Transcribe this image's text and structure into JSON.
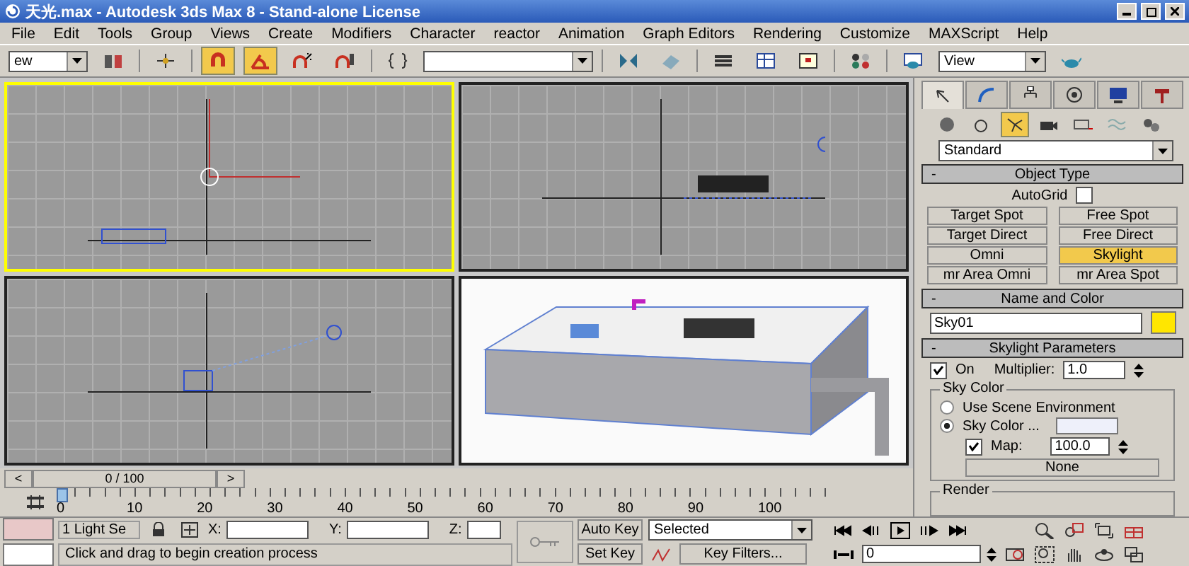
{
  "window": {
    "title": "天光.max - Autodesk 3ds Max 8  - Stand-alone License"
  },
  "menu": [
    "File",
    "Edit",
    "Tools",
    "Group",
    "Views",
    "Create",
    "Modifiers",
    "Character",
    "reactor",
    "Animation",
    "Graph Editors",
    "Rendering",
    "Customize",
    "MAXScript",
    "Help"
  ],
  "toolbar": {
    "selection_filter": "ew",
    "reference_coord": "View",
    "snaps": [
      {
        "kind": "snap",
        "selected": true
      },
      {
        "kind": "angle",
        "selected": true
      },
      {
        "kind": "percent",
        "selected": false
      },
      {
        "kind": "spinner",
        "selected": false
      }
    ]
  },
  "viewports": [
    {
      "kind": "top",
      "selected": true
    },
    {
      "kind": "front",
      "selected": false
    },
    {
      "kind": "left",
      "selected": false
    },
    {
      "kind": "perspective",
      "selected": false
    }
  ],
  "command_panel": {
    "tabs": [
      {
        "kind": "create",
        "selected": true
      },
      {
        "kind": "modify",
        "selected": false
      },
      {
        "kind": "hierarchy",
        "selected": false
      },
      {
        "kind": "motion",
        "selected": false
      },
      {
        "kind": "display",
        "selected": false
      },
      {
        "kind": "utilities",
        "selected": false
      }
    ],
    "categories": [
      {
        "kind": "geometry",
        "selected": false
      },
      {
        "kind": "shapes",
        "selected": false
      },
      {
        "kind": "lights",
        "selected": true
      },
      {
        "kind": "cameras",
        "selected": false
      },
      {
        "kind": "helpers",
        "selected": false
      },
      {
        "kind": "spacewarps",
        "selected": false
      },
      {
        "kind": "systems",
        "selected": false
      }
    ],
    "dropdown": "Standard",
    "object_type": {
      "toggle": "-",
      "title": "Object Type",
      "autogrid": {
        "label": "AutoGrid",
        "checked": false
      },
      "buttons": [
        {
          "label": "Target Spot",
          "selected": false
        },
        {
          "label": "Free Spot",
          "selected": false
        },
        {
          "label": "Target Direct",
          "selected": false
        },
        {
          "label": "Free Direct",
          "selected": false
        },
        {
          "label": "Omni",
          "selected": false
        },
        {
          "label": "Skylight",
          "selected": true
        },
        {
          "label": "mr Area Omni",
          "selected": false
        },
        {
          "label": "mr Area Spot",
          "selected": false
        }
      ]
    },
    "name_color": {
      "toggle": "-",
      "title": "Name and Color",
      "name": "Sky01",
      "color": "#ffe600"
    },
    "skylight": {
      "toggle": "-",
      "title": "Skylight Parameters",
      "on": {
        "label": "On",
        "checked": true
      },
      "multiplier": {
        "label": "Multiplier:",
        "value": "1.0"
      },
      "sky_color": {
        "title": "Sky Color",
        "options": [
          {
            "label": "Use Scene Environment",
            "selected": false
          },
          {
            "label": "Sky Color ...",
            "selected": true
          }
        ],
        "map": {
          "label": "Map:",
          "checked": true,
          "value": "100.0"
        },
        "map_button": "None"
      },
      "render_group": "Render"
    }
  },
  "time_slider": {
    "prev": "<",
    "label": "0 / 100",
    "next": ">"
  },
  "track_bar": {
    "ticks": [
      "0",
      "10",
      "20",
      "30",
      "40",
      "50",
      "60",
      "70",
      "80",
      "90",
      "100"
    ]
  },
  "status": {
    "selection": "1 Light Se",
    "x_label": "X:",
    "y_label": "Y:",
    "z_label": "Z:",
    "prompt": "Click and drag to begin creation process"
  },
  "animation": {
    "auto_key": "Auto Key",
    "key_mode": "Selected",
    "set_key": "Set Key",
    "key_filters": "Key Filters...",
    "frame": "0"
  }
}
